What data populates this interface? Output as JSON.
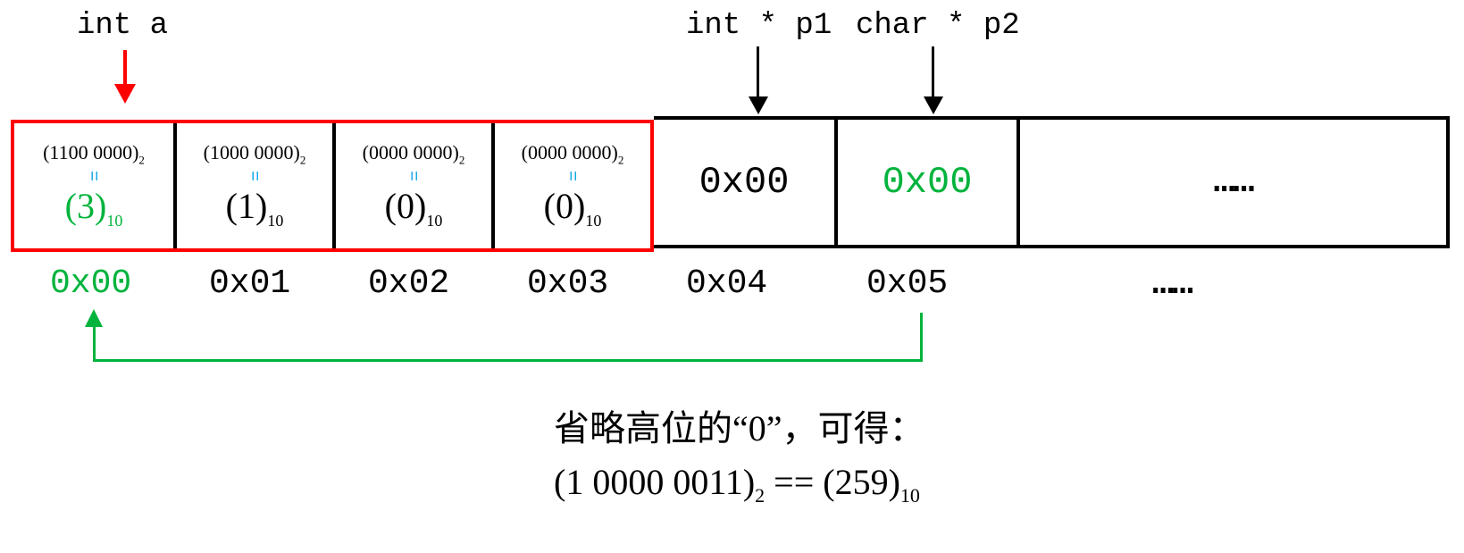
{
  "labels": {
    "int_a": "int a",
    "int_p1": "int * p1",
    "char_p2": "char * p2"
  },
  "cells": [
    {
      "bin": "(1100 0000)",
      "bin_base": "2",
      "dec": "(3)",
      "dec_base": "10",
      "dec_color": "green"
    },
    {
      "bin": "(1000 0000)",
      "bin_base": "2",
      "dec": "(1)",
      "dec_base": "10",
      "dec_color": "black"
    },
    {
      "bin": "(0000 0000)",
      "bin_base": "2",
      "dec": "(0)",
      "dec_base": "10",
      "dec_color": "black"
    },
    {
      "bin": "(0000 0000)",
      "bin_base": "2",
      "dec": "(0)",
      "dec_base": "10",
      "dec_color": "black"
    }
  ],
  "pcells": {
    "p1": "0x00",
    "p2": "0x00",
    "ellipsis": "……"
  },
  "addresses": [
    "0x00",
    "0x01",
    "0x02",
    "0x03",
    "0x04",
    "0x05",
    "……"
  ],
  "eq_symbol": "=",
  "footnote": {
    "line1": "省略高位的“0”，可得：",
    "line2_a": "(1 0000 0011)",
    "line2_b": "2",
    "line2_c": " == (259)",
    "line2_d": "10"
  }
}
